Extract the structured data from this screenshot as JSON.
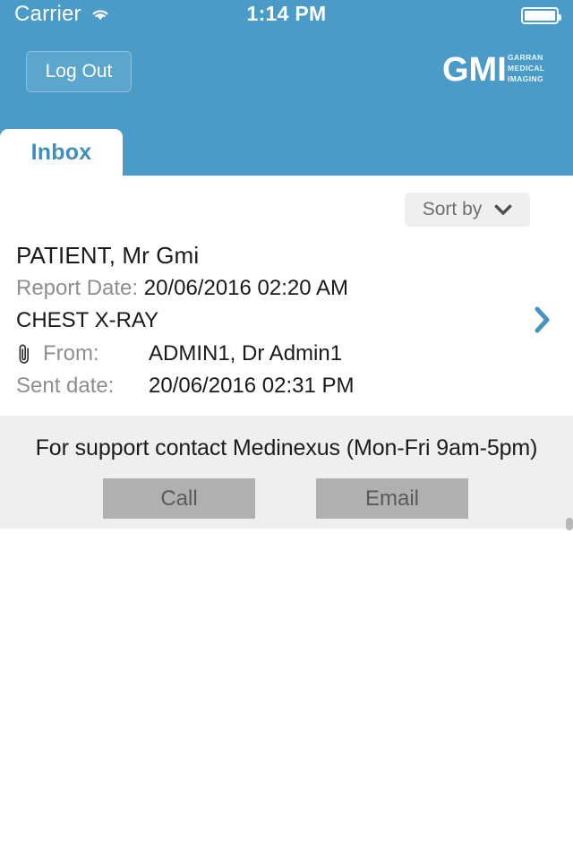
{
  "status_bar": {
    "carrier": "Carrier",
    "wifi_icon": "wifi-icon",
    "time": "1:14 PM",
    "battery_icon": "battery-full-icon"
  },
  "header": {
    "logout_label": "Log Out",
    "background_color": "#4a9bc7",
    "logo": {
      "name": "gmi-logo",
      "mark_text": "GMI",
      "line1": "GARRAN",
      "line2": "MEDICAL",
      "line3": "IMAGING"
    }
  },
  "tabs": [
    {
      "label": "Inbox",
      "active": true
    }
  ],
  "toolbar": {
    "sort_label": "Sort by",
    "sort_icon": "chevron-down-icon"
  },
  "records": [
    {
      "patient_name": "PATIENT, Mr Gmi",
      "report_date_label": "Report Date:",
      "report_date_value": "20/06/2016 02:20 AM",
      "modality": "CHEST X-RAY",
      "attachment_icon": "paperclip-icon",
      "from_label": "From:",
      "from_value": "ADMIN1, Dr Admin1",
      "sent_label": "Sent date:",
      "sent_value": "20/06/2016 02:31 PM",
      "disclosure_icon": "chevron-right-icon"
    }
  ],
  "support": {
    "message": "For support contact Medinexus (Mon-Fri 9am-5pm)",
    "call_label": "Call",
    "email_label": "Email",
    "background_color": "#efefef",
    "button_color": "#b0b0b0"
  },
  "colors": {
    "accent": "#4a9bc7",
    "tab_text": "#3f8fba",
    "label_gray": "#8e8e8e",
    "value_dark": "#1a1a1a"
  }
}
